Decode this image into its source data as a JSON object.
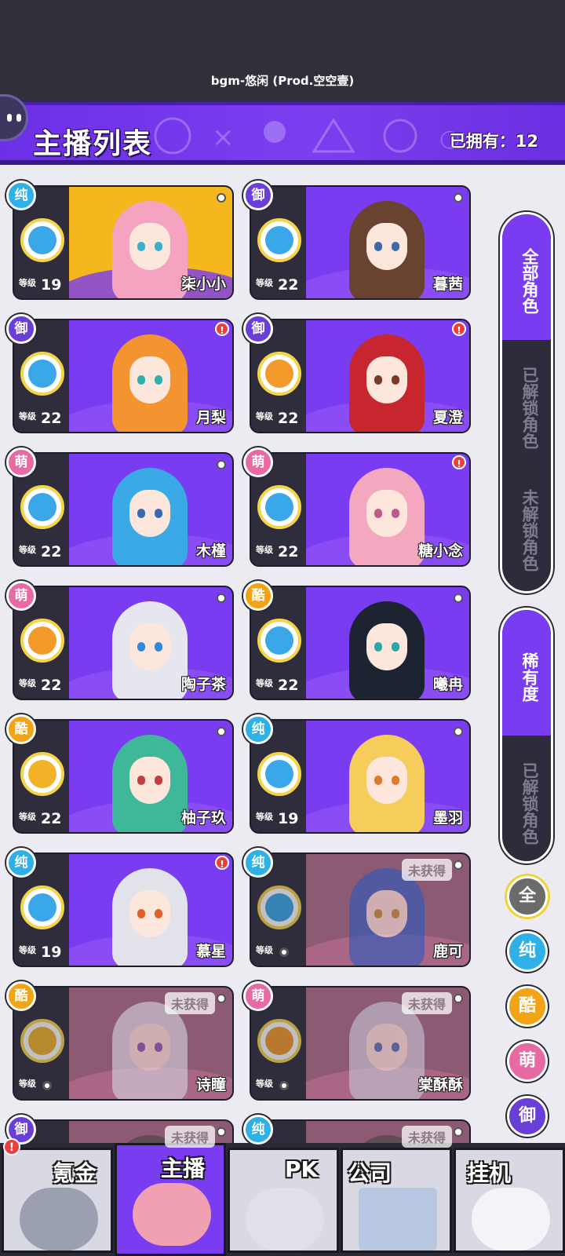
{
  "top": {
    "bgm": "bgm-悠闲 (Prod.空空壹)"
  },
  "header": {
    "title": "主播列表",
    "owned": "已拥有：12"
  },
  "cards": [
    {
      "name": "柒小小",
      "type": "纯",
      "level_label": "等级",
      "level": "19",
      "alert": "",
      "unobtained": "",
      "hair": "#f5a3c0",
      "eye": "#3bb0c8",
      "skill": "#3aa7e8",
      "gold": true
    },
    {
      "name": "暮茜",
      "type": "御",
      "level_label": "等级",
      "level": "22",
      "alert": "",
      "unobtained": "",
      "hair": "#6a4330",
      "eye": "#3d6aa6",
      "skill": "#3aa7e8"
    },
    {
      "name": "月梨",
      "type": "御",
      "level_label": "等级",
      "level": "22",
      "alert": "!",
      "unobtained": "",
      "hair": "#f39430",
      "eye": "#2eb0b0",
      "skill": "#3aa7e8"
    },
    {
      "name": "夏澄",
      "type": "御",
      "level_label": "等级",
      "level": "22",
      "alert": "!",
      "unobtained": "",
      "hair": "#c8262e",
      "eye": "#7a3a2a",
      "skill": "#f29a2a"
    },
    {
      "name": "木槿",
      "type": "萌",
      "level_label": "等级",
      "level": "22",
      "alert": "",
      "unobtained": "",
      "hair": "#3aa9e6",
      "eye": "#3a6ab0",
      "skill": "#3aa7e8"
    },
    {
      "name": "糖小念",
      "type": "萌",
      "level_label": "等级",
      "level": "22",
      "alert": "!",
      "unobtained": "",
      "hair": "#f3a8c0",
      "eye": "#c05a8a",
      "skill": "#3aa7e8"
    },
    {
      "name": "陶子茶",
      "type": "萌",
      "level_label": "等级",
      "level": "22",
      "alert": "",
      "unobtained": "",
      "hair": "#e6e6ee",
      "eye": "#2f8ad8",
      "skill": "#f29a2a"
    },
    {
      "name": "曦冉",
      "type": "酷",
      "level_label": "等级",
      "level": "22",
      "alert": "",
      "unobtained": "",
      "hair": "#1c2432",
      "eye": "#2aa8a8",
      "skill": "#3aa7e8"
    },
    {
      "name": "柚子玖",
      "type": "酷",
      "level_label": "等级",
      "level": "22",
      "alert": "",
      "unobtained": "",
      "hair": "#3fb89a",
      "eye": "#c04040",
      "skill": "#f2b22a"
    },
    {
      "name": "墨羽",
      "type": "纯",
      "level_label": "等级",
      "level": "19",
      "alert": "",
      "unobtained": "",
      "hair": "#f6cc5a",
      "eye": "#e07a2a",
      "skill": "#3aa7e8"
    },
    {
      "name": "慕星",
      "type": "纯",
      "level_label": "等级",
      "level": "19",
      "alert": "!",
      "unobtained": "",
      "hair": "#e2e2ea",
      "eye": "#e0602a",
      "skill": "#3aa7e8"
    },
    {
      "name": "鹿可",
      "type": "纯",
      "level_label": "等级",
      "level": "",
      "alert": "",
      "unobtained": "未获得",
      "hair": "#2a5ac0",
      "eye": "#c08a2a",
      "skill": "#3aa7e8",
      "locked": true
    },
    {
      "name": "诗瞳",
      "type": "酷",
      "level_label": "等级",
      "level": "",
      "alert": "",
      "unobtained": "未获得",
      "hair": "#d8d8e4",
      "eye": "#7a4ab0",
      "skill": "#f2b22a",
      "locked": true
    },
    {
      "name": "棠酥酥",
      "type": "萌",
      "level_label": "等级",
      "level": "",
      "alert": "",
      "unobtained": "未获得",
      "hair": "#c8c8d8",
      "eye": "#3a6ab0",
      "skill": "#f29a2a",
      "locked": true
    },
    {
      "name": "",
      "type": "御",
      "level_label": "",
      "level": "",
      "alert": "",
      "unobtained": "未获得",
      "hair": "#444",
      "eye": "#444",
      "skill": "#3aa7e8",
      "locked": true
    },
    {
      "name": "",
      "type": "纯",
      "level_label": "",
      "level": "",
      "alert": "",
      "unobtained": "未获得",
      "hair": "#444",
      "eye": "#444",
      "skill": "#3aa7e8",
      "locked": true,
      "gold": true
    }
  ],
  "side": {
    "all_roles": "全部角色",
    "unlocked": "已解锁角色",
    "locked": "未解锁角色",
    "rarity": "稀有度",
    "rarity_unlocked": "已解锁角色"
  },
  "filters": [
    "全",
    "纯",
    "酷",
    "萌",
    "御"
  ],
  "nav": {
    "items": [
      "氪金",
      "主播",
      "PK",
      "公司",
      "挂机"
    ],
    "alert": "!"
  },
  "colors": {
    "accent": "#7a3cf0",
    "pure": "#2fb0e6",
    "royal": "#6a3fd8",
    "cute": "#e86aa4",
    "cool": "#f2a416"
  }
}
